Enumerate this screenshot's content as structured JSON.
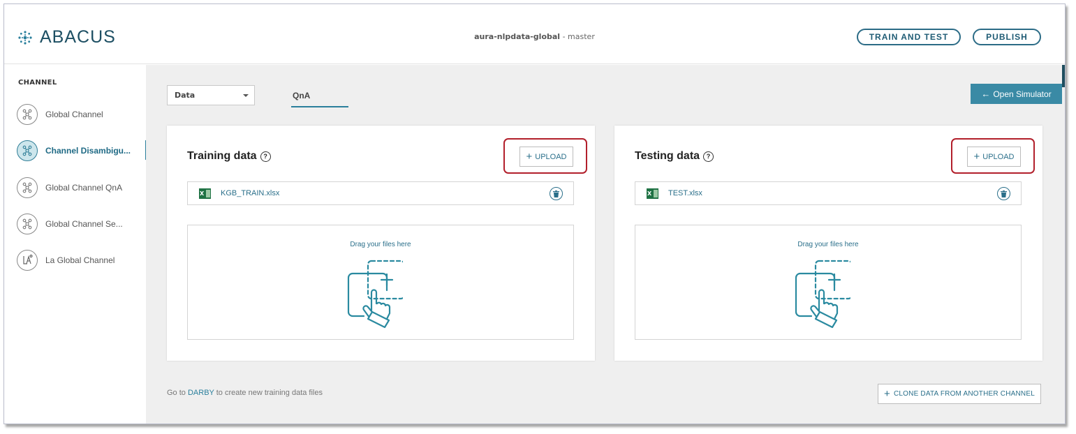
{
  "app": {
    "logo_text": "ABACUS",
    "project_name": "aura-nlpdata-global",
    "branch": " - master"
  },
  "header": {
    "train_test_label": "TRAIN AND TEST",
    "publish_label": "PUBLISH"
  },
  "sidebar": {
    "title": "CHANNEL",
    "items": [
      {
        "label": "Global Channel",
        "icon": "network-icon",
        "active": false
      },
      {
        "label": "Channel Disambigu...",
        "icon": "network-icon",
        "active": true
      },
      {
        "label": "Global Channel QnA",
        "icon": "network-icon",
        "active": false
      },
      {
        "label": "Global Channel Se...",
        "icon": "network-icon",
        "active": false
      },
      {
        "label": "La Global Channel",
        "icon": "la-logo-icon",
        "active": false
      }
    ]
  },
  "toolbar": {
    "dropdown_value": "Data",
    "tab_label": "QnA",
    "open_simulator_label": "Open Simulator"
  },
  "training": {
    "title": "Training data",
    "help": "?",
    "upload_label": "UPLOAD",
    "file_name": "KGB_TRAIN.xlsx",
    "drop_text": "Drag your files here"
  },
  "testing": {
    "title": "Testing data",
    "help": "?",
    "upload_label": "UPLOAD",
    "file_name": "TEST.xlsx",
    "drop_text": "Drag your files here"
  },
  "footer": {
    "prefix": "Go to ",
    "link": "DARBY",
    "suffix": " to create new training data files",
    "clone_label": "CLONE DATA FROM ANOTHER CHANNEL"
  },
  "colors": {
    "accent": "#2a7f9c",
    "highlight": "#b21f2b",
    "excel": "#1f7244"
  }
}
